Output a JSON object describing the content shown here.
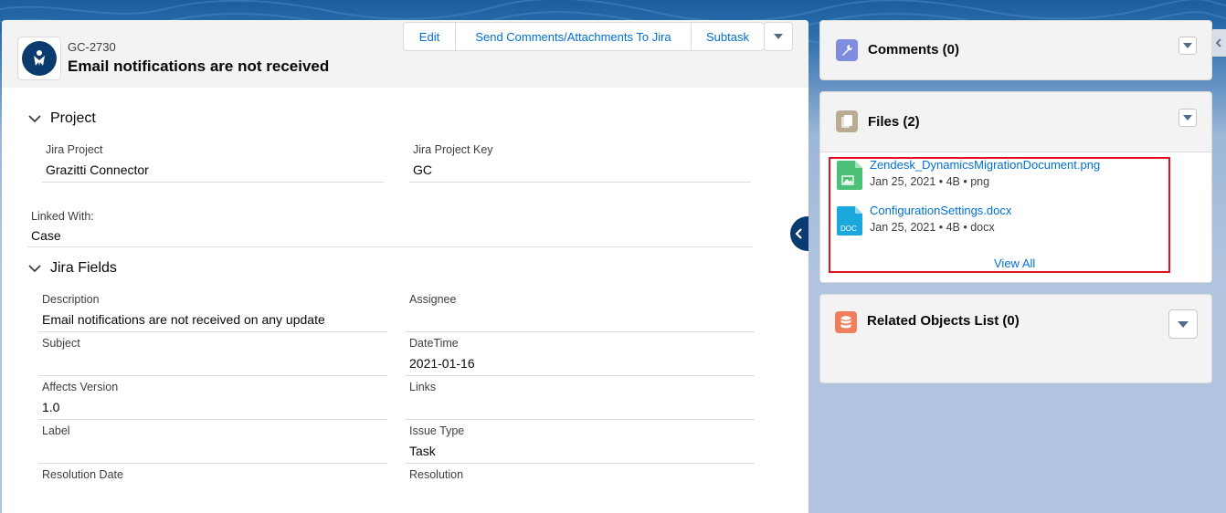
{
  "record": {
    "id": "GC-2730",
    "title": "Email notifications are not received",
    "actions": [
      "Edit",
      "Send Comments/Attachments To Jira",
      "Subtask"
    ]
  },
  "project_section": {
    "title": "Project",
    "fields": {
      "jira_project_label": "Jira Project",
      "jira_project_value": "Grazitti Connector",
      "jira_project_key_label": "Jira Project Key",
      "jira_project_key_value": "GC",
      "linked_with_label": "Linked With:",
      "linked_with_value": "Case"
    }
  },
  "jira_fields_section": {
    "title": "Jira Fields",
    "fields": {
      "description_label": "Description",
      "description_value": "Email notifications are not received on any update",
      "assignee_label": "Assignee",
      "subject_label": "Subject",
      "datetime_label": "DateTime",
      "datetime_value": "2021-01-16",
      "affects_version_label": "Affects Version",
      "affects_version_value": "1.0",
      "links_label": "Links",
      "label_label": "Label",
      "issue_type_label": "Issue Type",
      "issue_type_value": "Task",
      "resolution_date_label": "Resolution Date",
      "resolution_label": "Resolution"
    }
  },
  "comments": {
    "title": "Comments (0)"
  },
  "files": {
    "title": "Files (2)",
    "items": [
      {
        "name": "Zendesk_DynamicsMigrationDocument.png",
        "meta": "Jan 25, 2021 • 4B • png",
        "icon": "image-file-icon"
      },
      {
        "name": "ConfigurationSettings.docx",
        "meta": "Jan 25, 2021 • 4B • docx",
        "icon": "doc-file-icon",
        "icon_text": "DOC"
      }
    ],
    "view_all": "View All"
  },
  "related": {
    "title": "Related Objects List (0)"
  },
  "colors": {
    "link": "#0070d2",
    "brand_dark": "#0b3a6e",
    "highlight": "#e0101f",
    "comments_icon": "#7f8de1",
    "files_icon": "#baac93",
    "related_icon": "#ef7e5c",
    "image_file_icon": "#4bc076",
    "doc_file_icon": "#1ca8dd"
  }
}
